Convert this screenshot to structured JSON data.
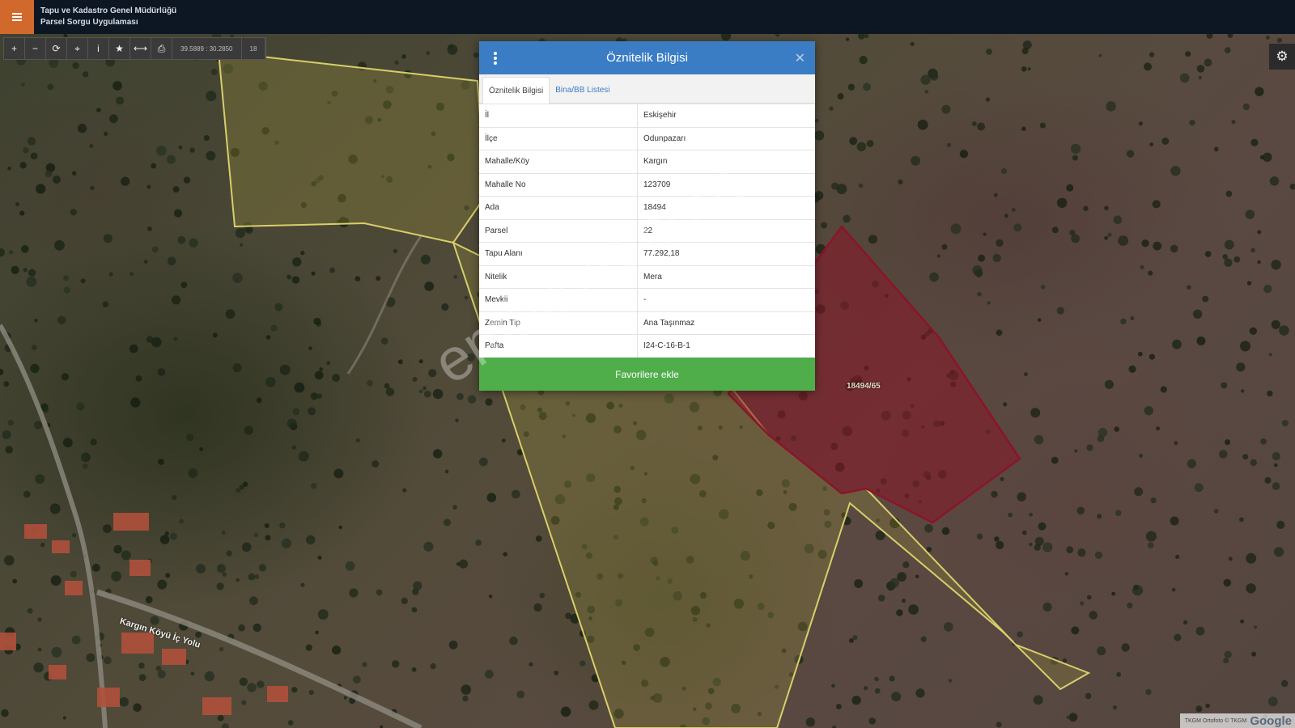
{
  "header": {
    "title_line1": "Tapu ve Kadastro Genel Müdürlüğü",
    "title_line2": "Parsel Sorgu Uygulaması",
    "menu_icon": "hamburger-icon",
    "accent_color": "#d2692c"
  },
  "toolbar": {
    "buttons": [
      {
        "icon": "zoom-in-icon",
        "glyph": "+"
      },
      {
        "icon": "zoom-out-icon",
        "glyph": "−"
      },
      {
        "icon": "refresh-icon",
        "glyph": "⟳"
      },
      {
        "icon": "locate-icon",
        "glyph": "⌖"
      },
      {
        "icon": "info-icon",
        "glyph": "i"
      },
      {
        "icon": "star-icon",
        "glyph": "★"
      },
      {
        "icon": "measure-icon",
        "glyph": "⟷"
      },
      {
        "icon": "print-icon",
        "glyph": "⎙"
      }
    ],
    "coordinates": "39.5889 : 30.2850",
    "zoom": "18"
  },
  "settings_icon": "gear-icon",
  "map": {
    "parcel_label": "18494/65",
    "road_label": "Kargın Köyü İç Yolu",
    "attribution_small": "TKGM Ortofoto © TKGM",
    "attribution_brand": "Google",
    "selected_parcel_color": "#8a1528",
    "boundary_color": "#d8cf6a"
  },
  "modal": {
    "title": "Öznitelik Bilgisi",
    "header_color": "#3b7dc4",
    "tabs": [
      "Öznitelik Bilgisi",
      "Bina/BB Listesi"
    ],
    "rows": [
      {
        "key": "İl",
        "value": "Eskişehir"
      },
      {
        "key": "İlçe",
        "value": "Odunpazarı"
      },
      {
        "key": "Mahalle/Köy",
        "value": "Kargın"
      },
      {
        "key": "Mahalle No",
        "value": "123709"
      },
      {
        "key": "Ada",
        "value": "18494"
      },
      {
        "key": "Parsel",
        "value": "22"
      },
      {
        "key": "Tapu Alanı",
        "value": "77.292,18"
      },
      {
        "key": "Nitelik",
        "value": "Mera"
      },
      {
        "key": "Mevkii",
        "value": "-"
      },
      {
        "key": "Zemin Tip",
        "value": "Ana Taşınmaz"
      },
      {
        "key": "Pafta",
        "value": "I24-C-16-B-1"
      }
    ],
    "favorite_button": "Favorilere ekle",
    "favorite_color": "#4fad4a"
  },
  "watermark": "emlakjet.com"
}
